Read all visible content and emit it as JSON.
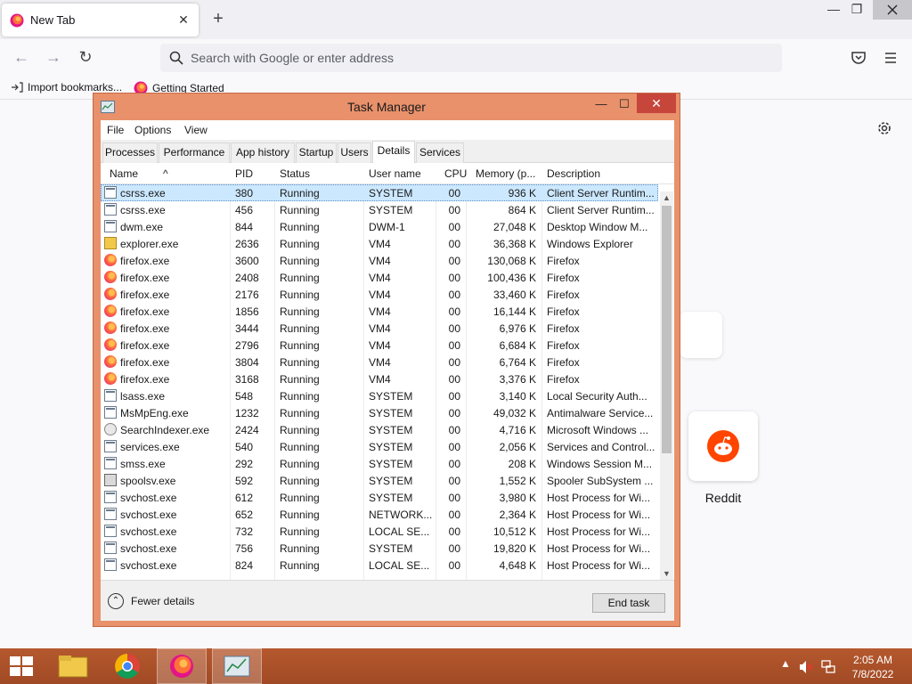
{
  "browser": {
    "tab_title": "New Tab",
    "url_placeholder": "Search with Google or enter address",
    "bookmarks": [
      "Import bookmarks...",
      "Getting Started"
    ],
    "top_site_label": "Reddit"
  },
  "task_manager": {
    "title": "Task Manager",
    "menu": [
      "File",
      "Options",
      "View"
    ],
    "tabs": [
      "Processes",
      "Performance",
      "App history",
      "Startup",
      "Users",
      "Details",
      "Services"
    ],
    "active_tab": "Details",
    "columns": [
      "Name",
      "PID",
      "Status",
      "User name",
      "CPU",
      "Memory (p...",
      "Description"
    ],
    "rows": [
      {
        "icon": "generic",
        "name": "csrss.exe",
        "pid": "380",
        "status": "Running",
        "user": "SYSTEM",
        "cpu": "00",
        "memory": "936 K",
        "description": "Client Server Runtim..."
      },
      {
        "icon": "generic",
        "name": "csrss.exe",
        "pid": "456",
        "status": "Running",
        "user": "SYSTEM",
        "cpu": "00",
        "memory": "864 K",
        "description": "Client Server Runtim..."
      },
      {
        "icon": "generic",
        "name": "dwm.exe",
        "pid": "844",
        "status": "Running",
        "user": "DWM-1",
        "cpu": "00",
        "memory": "27,048 K",
        "description": "Desktop Window M..."
      },
      {
        "icon": "folder",
        "name": "explorer.exe",
        "pid": "2636",
        "status": "Running",
        "user": "VM4",
        "cpu": "00",
        "memory": "36,368 K",
        "description": "Windows Explorer"
      },
      {
        "icon": "firefox",
        "name": "firefox.exe",
        "pid": "3600",
        "status": "Running",
        "user": "VM4",
        "cpu": "00",
        "memory": "130,068 K",
        "description": "Firefox"
      },
      {
        "icon": "firefox",
        "name": "firefox.exe",
        "pid": "2408",
        "status": "Running",
        "user": "VM4",
        "cpu": "00",
        "memory": "100,436 K",
        "description": "Firefox"
      },
      {
        "icon": "firefox",
        "name": "firefox.exe",
        "pid": "2176",
        "status": "Running",
        "user": "VM4",
        "cpu": "00",
        "memory": "33,460 K",
        "description": "Firefox"
      },
      {
        "icon": "firefox",
        "name": "firefox.exe",
        "pid": "1856",
        "status": "Running",
        "user": "VM4",
        "cpu": "00",
        "memory": "16,144 K",
        "description": "Firefox"
      },
      {
        "icon": "firefox",
        "name": "firefox.exe",
        "pid": "3444",
        "status": "Running",
        "user": "VM4",
        "cpu": "00",
        "memory": "6,976 K",
        "description": "Firefox"
      },
      {
        "icon": "firefox",
        "name": "firefox.exe",
        "pid": "2796",
        "status": "Running",
        "user": "VM4",
        "cpu": "00",
        "memory": "6,684 K",
        "description": "Firefox"
      },
      {
        "icon": "firefox",
        "name": "firefox.exe",
        "pid": "3804",
        "status": "Running",
        "user": "VM4",
        "cpu": "00",
        "memory": "6,764 K",
        "description": "Firefox"
      },
      {
        "icon": "firefox",
        "name": "firefox.exe",
        "pid": "3168",
        "status": "Running",
        "user": "VM4",
        "cpu": "00",
        "memory": "3,376 K",
        "description": "Firefox"
      },
      {
        "icon": "generic",
        "name": "lsass.exe",
        "pid": "548",
        "status": "Running",
        "user": "SYSTEM",
        "cpu": "00",
        "memory": "3,140 K",
        "description": "Local Security Auth..."
      },
      {
        "icon": "generic",
        "name": "MsMpEng.exe",
        "pid": "1232",
        "status": "Running",
        "user": "SYSTEM",
        "cpu": "00",
        "memory": "49,032 K",
        "description": "Antimalware Service..."
      },
      {
        "icon": "search",
        "name": "SearchIndexer.exe",
        "pid": "2424",
        "status": "Running",
        "user": "SYSTEM",
        "cpu": "00",
        "memory": "4,716 K",
        "description": "Microsoft Windows ..."
      },
      {
        "icon": "generic",
        "name": "services.exe",
        "pid": "540",
        "status": "Running",
        "user": "SYSTEM",
        "cpu": "00",
        "memory": "2,056 K",
        "description": "Services and Control..."
      },
      {
        "icon": "generic",
        "name": "smss.exe",
        "pid": "292",
        "status": "Running",
        "user": "SYSTEM",
        "cpu": "00",
        "memory": "208 K",
        "description": "Windows Session M..."
      },
      {
        "icon": "printer",
        "name": "spoolsv.exe",
        "pid": "592",
        "status": "Running",
        "user": "SYSTEM",
        "cpu": "00",
        "memory": "1,552 K",
        "description": "Spooler SubSystem ..."
      },
      {
        "icon": "generic",
        "name": "svchost.exe",
        "pid": "612",
        "status": "Running",
        "user": "SYSTEM",
        "cpu": "00",
        "memory": "3,980 K",
        "description": "Host Process for Wi..."
      },
      {
        "icon": "generic",
        "name": "svchost.exe",
        "pid": "652",
        "status": "Running",
        "user": "NETWORK...",
        "cpu": "00",
        "memory": "2,364 K",
        "description": "Host Process for Wi..."
      },
      {
        "icon": "generic",
        "name": "svchost.exe",
        "pid": "732",
        "status": "Running",
        "user": "LOCAL SE...",
        "cpu": "00",
        "memory": "10,512 K",
        "description": "Host Process for Wi..."
      },
      {
        "icon": "generic",
        "name": "svchost.exe",
        "pid": "756",
        "status": "Running",
        "user": "SYSTEM",
        "cpu": "00",
        "memory": "19,820 K",
        "description": "Host Process for Wi..."
      },
      {
        "icon": "generic",
        "name": "svchost.exe",
        "pid": "824",
        "status": "Running",
        "user": "LOCAL SE...",
        "cpu": "00",
        "memory": "4,648 K",
        "description": "Host Process for Wi..."
      }
    ],
    "selected_row": 0,
    "fewer_details": "Fewer details",
    "end_task": "End task"
  },
  "taskbar": {
    "time": "2:05 AM",
    "date": "7/8/2022"
  },
  "colors": {
    "window_frame": "#e8916b",
    "taskbar": "#b5582e",
    "close_button": "#c7463c",
    "selected_row": "#cce8ff"
  }
}
